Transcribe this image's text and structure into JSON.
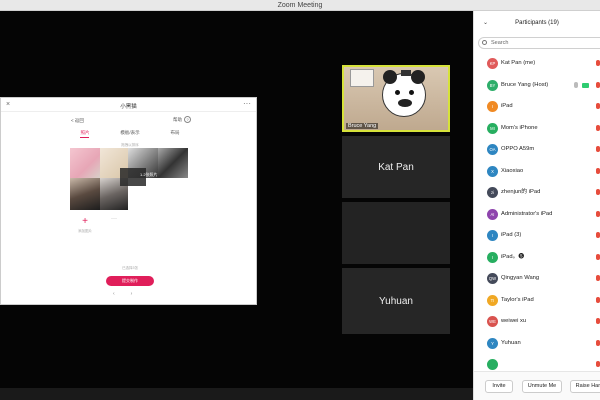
{
  "window": {
    "title": "Zoom Meeting"
  },
  "share": {
    "title": "小黑猫",
    "back_label": "< 返回",
    "help_label": "帮助",
    "help_icon_text": "?",
    "tabs": [
      "照片",
      "模板/表示",
      "布局"
    ],
    "hint": "拖拽以排序",
    "drag_label": "1.2张照片",
    "add_label": "添加图片",
    "sub_label": "已选择3张",
    "next_button": "提交制作",
    "nav": [
      "‹",
      "›"
    ]
  },
  "tiles": [
    {
      "name": "Bruce Yang"
    },
    {
      "name": "Kat Pan"
    },
    {
      "name": ""
    },
    {
      "name": "Yuhuan"
    }
  ],
  "participants": {
    "title": "Participants (19)",
    "search_placeholder": "Search",
    "items": [
      {
        "initials": "KP",
        "name": "Kat Pan (me)",
        "color": "#e05a5a"
      },
      {
        "initials": "BY",
        "name": "Bruce Yang (Host)",
        "color": "#2eae6a"
      },
      {
        "initials": "I",
        "name": "iPad",
        "color": "#f08a24"
      },
      {
        "initials": "MI",
        "name": "Mom's iPhone",
        "color": "#27ae60"
      },
      {
        "initials": "OA",
        "name": "OPPO A59m",
        "color": "#2e86c1"
      },
      {
        "initials": "X",
        "name": "Xiaoxiao",
        "color": "#2e86c1"
      },
      {
        "initials": "zi",
        "name": "zhenjun的 iPad",
        "color": "#444a5a"
      },
      {
        "initials": "AI",
        "name": "Administrator's iPad",
        "color": "#8e44ad"
      },
      {
        "initials": "I",
        "name": "iPad (3)",
        "color": "#2e86c1"
      },
      {
        "initials": "I",
        "name": "iPad。🅢",
        "color": "#27ae60"
      },
      {
        "initials": "QW",
        "name": "Qingyan Wang",
        "color": "#444a5a"
      },
      {
        "initials": "TI",
        "name": "Taylor's iPad",
        "color": "#f0a824"
      },
      {
        "initials": "WE",
        "name": "weiwei xu",
        "color": "#d9534f"
      },
      {
        "initials": "Y",
        "name": "Yuhuan",
        "color": "#2e86c1"
      },
      {
        "initials": "",
        "name": "",
        "color": "#27ae60"
      }
    ]
  },
  "footer": {
    "invite": "Invite",
    "unmute": "Unmute Me",
    "raise": "Raise Hand"
  }
}
